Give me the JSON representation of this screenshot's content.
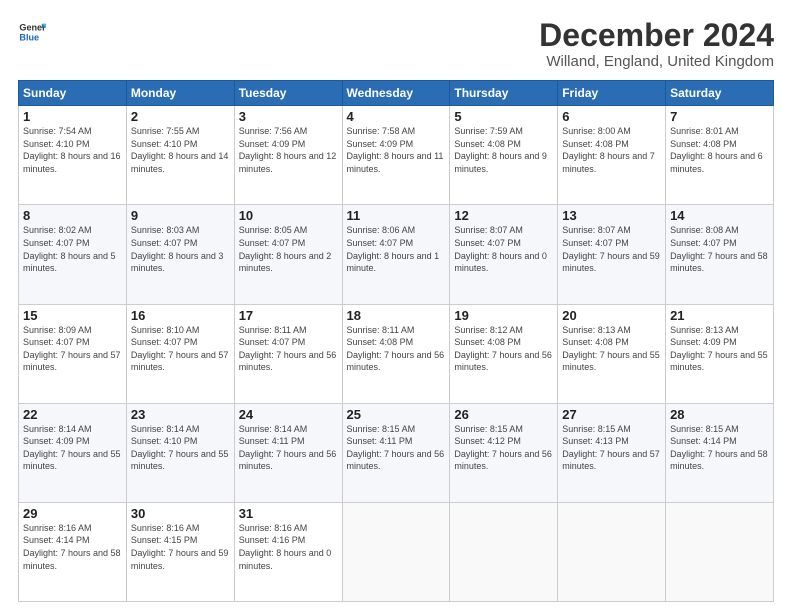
{
  "logo": {
    "line1": "General",
    "line2": "Blue"
  },
  "title": "December 2024",
  "subtitle": "Willand, England, United Kingdom",
  "days_header": [
    "Sunday",
    "Monday",
    "Tuesday",
    "Wednesday",
    "Thursday",
    "Friday",
    "Saturday"
  ],
  "weeks": [
    [
      {
        "day": "1",
        "sunrise": "7:54 AM",
        "sunset": "4:10 PM",
        "daylight": "8 hours and 16 minutes."
      },
      {
        "day": "2",
        "sunrise": "7:55 AM",
        "sunset": "4:10 PM",
        "daylight": "8 hours and 14 minutes."
      },
      {
        "day": "3",
        "sunrise": "7:56 AM",
        "sunset": "4:09 PM",
        "daylight": "8 hours and 12 minutes."
      },
      {
        "day": "4",
        "sunrise": "7:58 AM",
        "sunset": "4:09 PM",
        "daylight": "8 hours and 11 minutes."
      },
      {
        "day": "5",
        "sunrise": "7:59 AM",
        "sunset": "4:08 PM",
        "daylight": "8 hours and 9 minutes."
      },
      {
        "day": "6",
        "sunrise": "8:00 AM",
        "sunset": "4:08 PM",
        "daylight": "8 hours and 7 minutes."
      },
      {
        "day": "7",
        "sunrise": "8:01 AM",
        "sunset": "4:08 PM",
        "daylight": "8 hours and 6 minutes."
      }
    ],
    [
      {
        "day": "8",
        "sunrise": "8:02 AM",
        "sunset": "4:07 PM",
        "daylight": "8 hours and 5 minutes."
      },
      {
        "day": "9",
        "sunrise": "8:03 AM",
        "sunset": "4:07 PM",
        "daylight": "8 hours and 3 minutes."
      },
      {
        "day": "10",
        "sunrise": "8:05 AM",
        "sunset": "4:07 PM",
        "daylight": "8 hours and 2 minutes."
      },
      {
        "day": "11",
        "sunrise": "8:06 AM",
        "sunset": "4:07 PM",
        "daylight": "8 hours and 1 minute."
      },
      {
        "day": "12",
        "sunrise": "8:07 AM",
        "sunset": "4:07 PM",
        "daylight": "8 hours and 0 minutes."
      },
      {
        "day": "13",
        "sunrise": "8:07 AM",
        "sunset": "4:07 PM",
        "daylight": "7 hours and 59 minutes."
      },
      {
        "day": "14",
        "sunrise": "8:08 AM",
        "sunset": "4:07 PM",
        "daylight": "7 hours and 58 minutes."
      }
    ],
    [
      {
        "day": "15",
        "sunrise": "8:09 AM",
        "sunset": "4:07 PM",
        "daylight": "7 hours and 57 minutes."
      },
      {
        "day": "16",
        "sunrise": "8:10 AM",
        "sunset": "4:07 PM",
        "daylight": "7 hours and 57 minutes."
      },
      {
        "day": "17",
        "sunrise": "8:11 AM",
        "sunset": "4:07 PM",
        "daylight": "7 hours and 56 minutes."
      },
      {
        "day": "18",
        "sunrise": "8:11 AM",
        "sunset": "4:08 PM",
        "daylight": "7 hours and 56 minutes."
      },
      {
        "day": "19",
        "sunrise": "8:12 AM",
        "sunset": "4:08 PM",
        "daylight": "7 hours and 56 minutes."
      },
      {
        "day": "20",
        "sunrise": "8:13 AM",
        "sunset": "4:08 PM",
        "daylight": "7 hours and 55 minutes."
      },
      {
        "day": "21",
        "sunrise": "8:13 AM",
        "sunset": "4:09 PM",
        "daylight": "7 hours and 55 minutes."
      }
    ],
    [
      {
        "day": "22",
        "sunrise": "8:14 AM",
        "sunset": "4:09 PM",
        "daylight": "7 hours and 55 minutes."
      },
      {
        "day": "23",
        "sunrise": "8:14 AM",
        "sunset": "4:10 PM",
        "daylight": "7 hours and 55 minutes."
      },
      {
        "day": "24",
        "sunrise": "8:14 AM",
        "sunset": "4:11 PM",
        "daylight": "7 hours and 56 minutes."
      },
      {
        "day": "25",
        "sunrise": "8:15 AM",
        "sunset": "4:11 PM",
        "daylight": "7 hours and 56 minutes."
      },
      {
        "day": "26",
        "sunrise": "8:15 AM",
        "sunset": "4:12 PM",
        "daylight": "7 hours and 56 minutes."
      },
      {
        "day": "27",
        "sunrise": "8:15 AM",
        "sunset": "4:13 PM",
        "daylight": "7 hours and 57 minutes."
      },
      {
        "day": "28",
        "sunrise": "8:15 AM",
        "sunset": "4:14 PM",
        "daylight": "7 hours and 58 minutes."
      }
    ],
    [
      {
        "day": "29",
        "sunrise": "8:16 AM",
        "sunset": "4:14 PM",
        "daylight": "7 hours and 58 minutes."
      },
      {
        "day": "30",
        "sunrise": "8:16 AM",
        "sunset": "4:15 PM",
        "daylight": "7 hours and 59 minutes."
      },
      {
        "day": "31",
        "sunrise": "8:16 AM",
        "sunset": "4:16 PM",
        "daylight": "8 hours and 0 minutes."
      },
      null,
      null,
      null,
      null
    ]
  ]
}
